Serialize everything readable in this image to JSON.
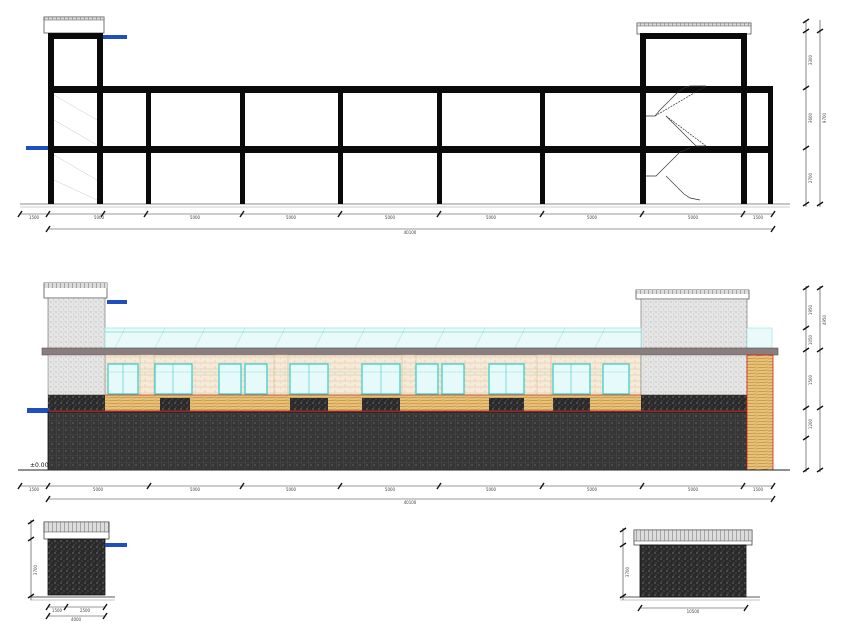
{
  "section": {
    "dims": [
      "1500",
      "5000",
      "5000",
      "5000",
      "5000",
      "5000",
      "5000",
      "5000",
      "1500"
    ],
    "total": "40100",
    "right_dims": [
      "3300",
      "3600",
      "2700"
    ],
    "right_total": "9700"
  },
  "facade": {
    "level_mark": "±0.00",
    "dims": [
      "1500",
      "5000",
      "5000",
      "5000",
      "5000",
      "5000",
      "5000",
      "5000",
      "1500"
    ],
    "total": "40100",
    "right_dims": [
      "1950",
      "1050",
      "1500",
      "1200"
    ],
    "right_total": "4950"
  },
  "side_left": {
    "dims": [
      "1500",
      "2500"
    ],
    "total": "4000",
    "height": "3700"
  },
  "side_right": {
    "width": "10500",
    "height": "3700"
  },
  "colors": {
    "structure": "#0a0a0a",
    "glass": "#33cccc",
    "railing": "#8fe3e3",
    "canopy": "#1f4fbf",
    "wall_dark": "#2e2e2e",
    "timber": "#d9a441",
    "red_line": "#d02020",
    "cornice": "#8a7d7d"
  }
}
